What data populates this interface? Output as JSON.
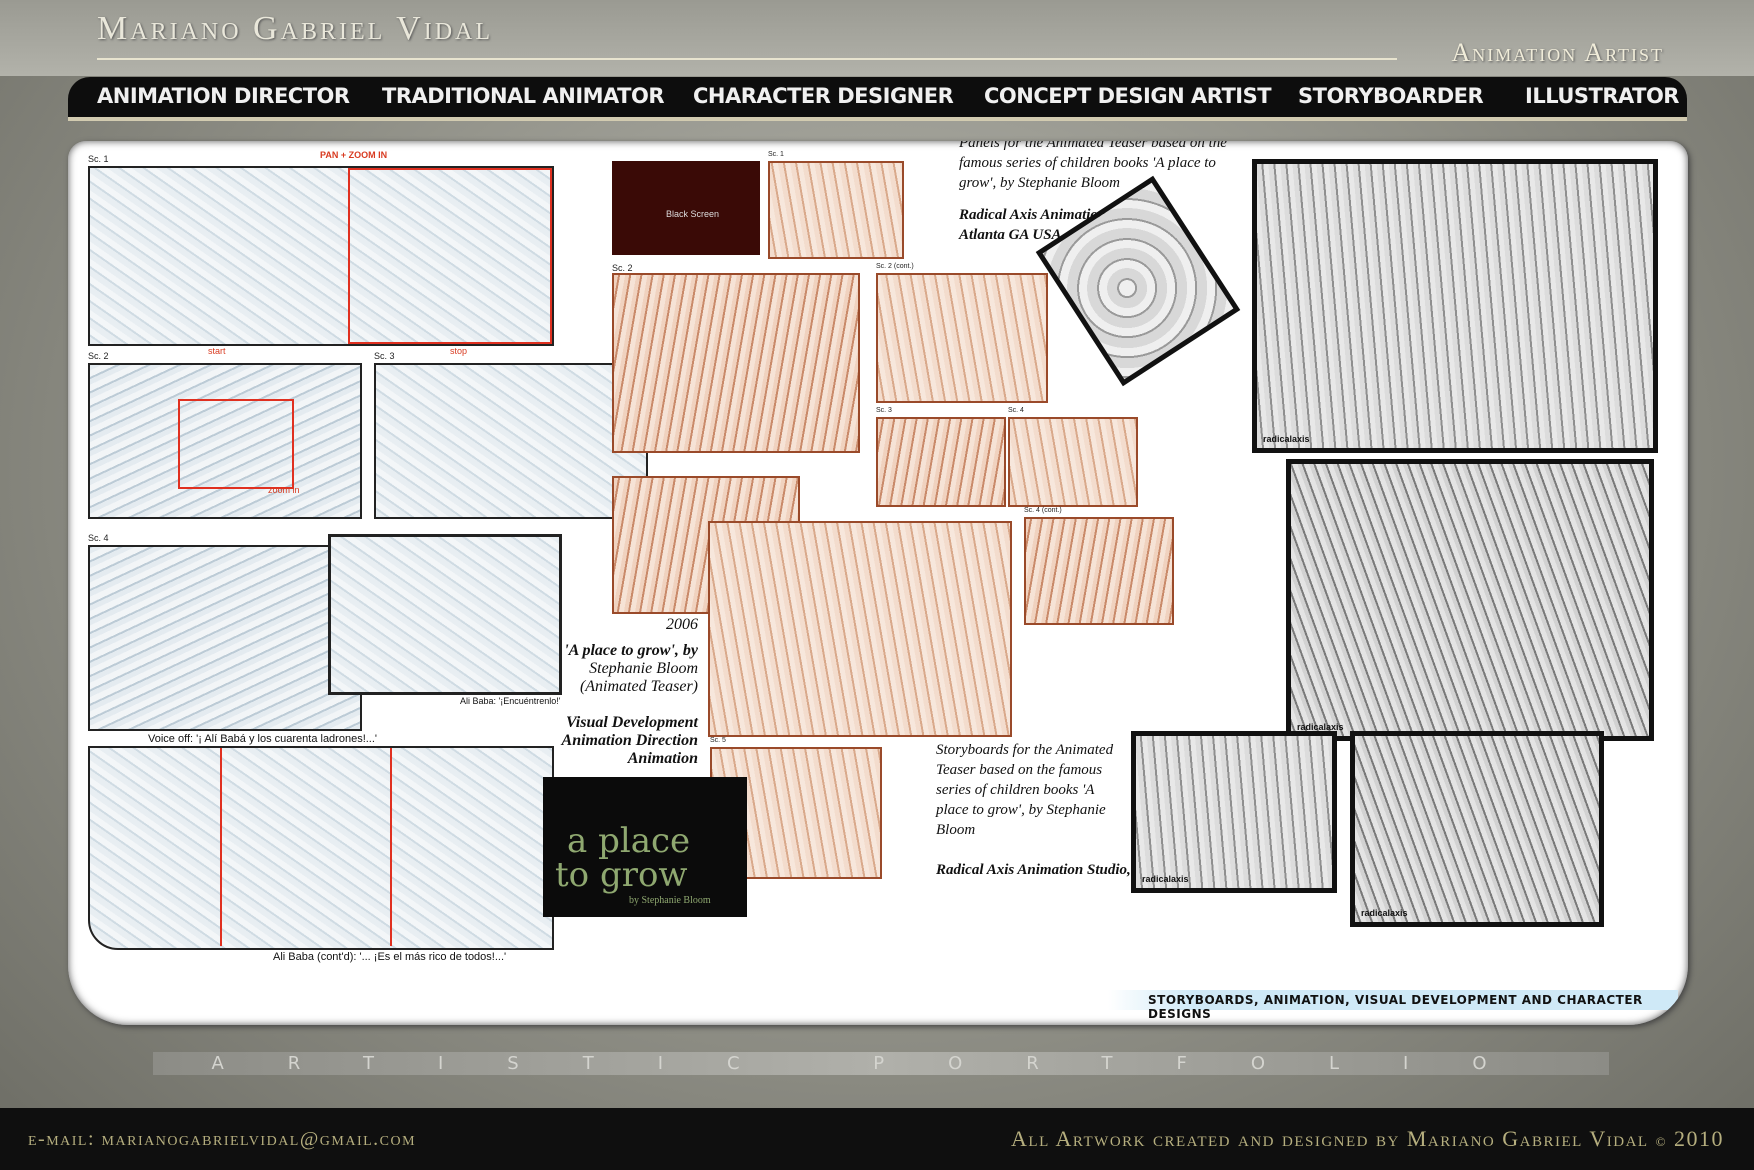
{
  "header": {
    "name": "Mariano Gabriel Vidal",
    "role": "Animation Artist"
  },
  "nav": {
    "items": [
      "ANIMATION DIRECTOR",
      "TRADITIONAL ANIMATOR",
      "CHARACTER DESIGNER",
      "CONCEPT DESIGN ARTIST",
      "STORYBOARDER",
      "ILLUSTRATOR"
    ]
  },
  "alibaba": {
    "sc1": "Sc. 1",
    "pan_zoom": "PAN + ZOOM IN",
    "start": "start",
    "stop": "stop",
    "sc2": "Sc. 2",
    "zoom_in": "zoom in",
    "sc3": "Sc. 3",
    "sc4": "Sc. 4",
    "caption_encuentrenlo": "Ali Baba: '¡Encuéntrenlo!'",
    "voice_off": "Voice off: '¡ Alí Babá y los cuarenta ladrones!...'",
    "caption_rico": "Ali Baba (cont'd): '... ¡Es el más rico de todos!...'"
  },
  "teaser": {
    "black_screen": "Black Screen",
    "sc1": "Sc. 1",
    "sc2": "Sc. 2",
    "sc2_cont": "Sc. 2 (cont.)",
    "sc3": "Sc. 3",
    "sc4": "Sc. 4",
    "sc4_cont": "Sc. 4 (cont.)",
    "sc5": "Sc. 5",
    "year": "2006",
    "title": "'A place to grow', by",
    "author": "Stephanie Bloom",
    "type": "(Animated Teaser)",
    "credits": [
      "Visual Development",
      "Animation Direction",
      "Animation"
    ],
    "logo_line1": "a place",
    "logo_line2": "to grow",
    "logo_by": "by Stephanie Bloom"
  },
  "panels_note": {
    "text": "Panels for the Animated Teaser based on the famous series of children books 'A place to grow', by Stephanie Bloom",
    "studio": "Radical Axis Animation Studio, Atlanta GA USA"
  },
  "storyboards_note": {
    "text": "Storyboards for the Animated Teaser based on the famous series of children books 'A place to grow', by Stephanie Bloom",
    "studio": "Radical Axis Animation Studio, Atlanta GA, USA"
  },
  "brand_tag": "radicalaxis",
  "strip_label": "STORYBOARDS, ANIMATION, VISUAL DEVELOPMENT AND CHARACTER DESIGNS",
  "portfolio_label": "ARTISTIC PORTFOLIO",
  "footer": {
    "email_label": "e-mail: marianogabrielvidal@gmail.com",
    "credit": "All Artwork created and designed by Mariano Gabriel Vidal",
    "copyright": "©",
    "year": "2010"
  },
  "colors": {
    "accent_red": "#e03020",
    "footer_text": "#b5ae7e",
    "nav_bg": "#0d0d0d"
  }
}
